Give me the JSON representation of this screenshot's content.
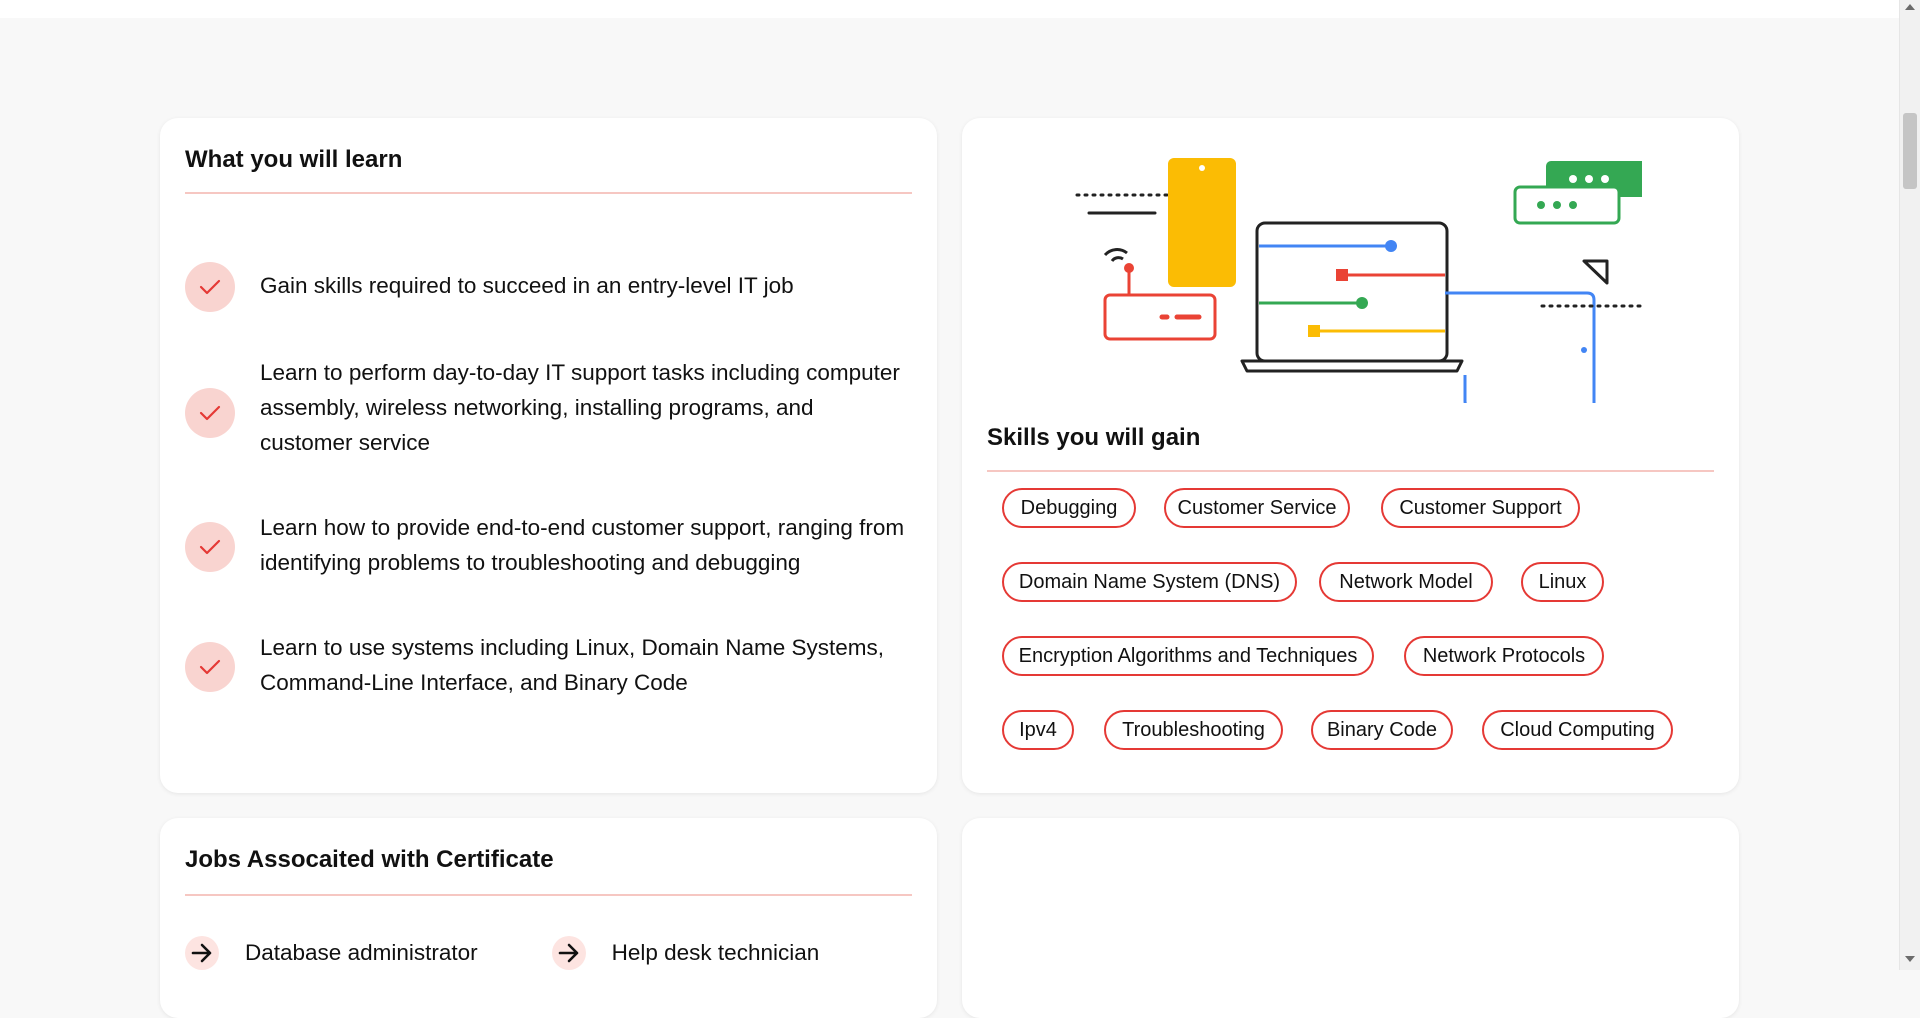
{
  "learn": {
    "title": "What you will learn",
    "items": [
      "Gain skills required to succeed in an entry-level IT job",
      "Learn to perform day-to-day IT support tasks including computer assembly, wireless networking, installing programs, and customer service",
      "Learn how to provide end-to-end customer support, ranging from identifying problems to troubleshooting and debugging",
      "Learn to use systems including Linux, Domain Name Systems, Command-Line Interface, and Binary Code"
    ]
  },
  "skills": {
    "title": "Skills you will gain",
    "tags": [
      "Debugging",
      "Customer Service",
      "Customer Support",
      "Domain Name System (DNS)",
      "Network Model",
      "Linux",
      "Encryption Algorithms and Techniques",
      "Network Protocols",
      "Ipv4",
      "Troubleshooting",
      "Binary Code",
      "Cloud Computing"
    ]
  },
  "jobs": {
    "title": "Jobs Assocaited with Certificate",
    "items": [
      "Database administrator",
      "Help desk technician"
    ]
  },
  "colors": {
    "accent": "#e53935",
    "check_bg": "#f9d4d0",
    "divider": "#f6c7c2",
    "illus_blue": "#4285f4",
    "illus_red": "#ea4335",
    "illus_green": "#34a853",
    "illus_yellow": "#fbbc04"
  },
  "icons": {
    "check": "check-icon",
    "arrow": "arrow-right-icon"
  }
}
